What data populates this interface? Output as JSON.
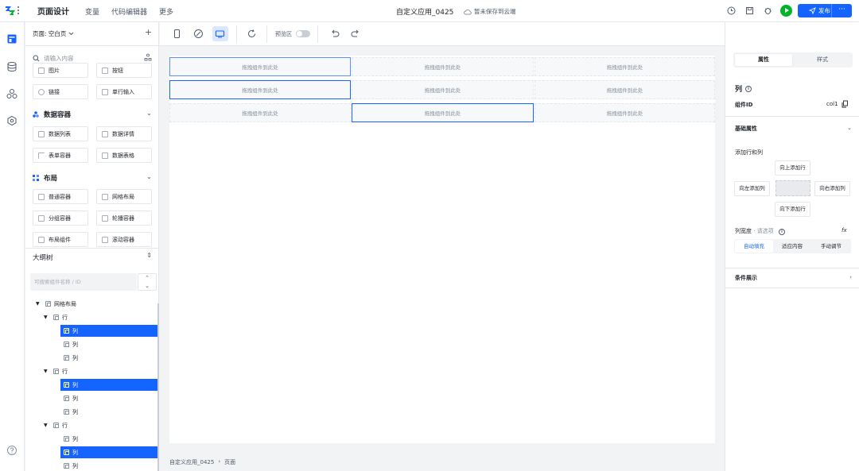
{
  "topbar": {
    "title": "页面设计",
    "nav": [
      "变量",
      "代码编辑器",
      "更多"
    ],
    "app_name": "自定义应用_0425",
    "save_status": "暂未保存到云端",
    "publish_label": "发布",
    "publish_more": "···",
    "accent": "#1664ff",
    "run_color": "#00b42a"
  },
  "left_panel": {
    "page_label": "页面: 空白页",
    "search_placeholder": "请输入内容",
    "components_top": [
      {
        "label": "图片"
      },
      {
        "label": "按钮"
      },
      {
        "label": "链接"
      },
      {
        "label": "单行输入"
      }
    ],
    "section_data": {
      "title": "数据容器",
      "items": [
        {
          "label": "数据列表"
        },
        {
          "label": "数据详情"
        },
        {
          "label": "表单容器"
        },
        {
          "label": "数据表格"
        }
      ]
    },
    "section_layout": {
      "title": "布局",
      "items": [
        {
          "label": "普通容器"
        },
        {
          "label": "网格布局"
        },
        {
          "label": "分组容器"
        },
        {
          "label": "轮播容器"
        },
        {
          "label": "布局组件"
        },
        {
          "label": "滚动容器"
        }
      ]
    },
    "outline": {
      "title": "大纲树",
      "search_placeholder": "可搜索组件名称 / ID",
      "root": "网格布局",
      "row_label": "行",
      "col_label": "列"
    }
  },
  "toolbar": {
    "preview_label": "预览区"
  },
  "canvas": {
    "placeholder": "拖拽组件到此处",
    "breadcrumb": [
      "自定义应用_0425",
      "›",
      "页面"
    ]
  },
  "right_panel": {
    "tabs": [
      "属性",
      "样式"
    ],
    "component_title": "列",
    "component_id_label": "组件ID",
    "component_id_value": "col1",
    "basic_section": "基础属性",
    "add_rowcol_label": "添加行和列",
    "add_up": "向上添加行",
    "add_left": "向左添加列",
    "add_right": "向右添加列",
    "add_down": "向下添加行",
    "col_width_label": "列宽度",
    "required_mark": "· 请选项",
    "fx": "fx",
    "width_options": [
      "自动填充",
      "适应内容",
      "手动调节"
    ],
    "condition_section": "条件展示"
  }
}
